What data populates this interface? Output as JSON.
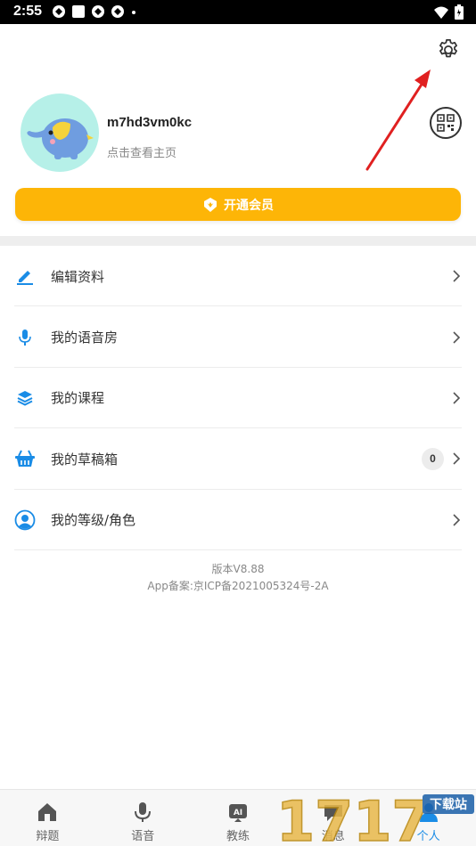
{
  "status_bar": {
    "time": "2:55"
  },
  "profile": {
    "username": "m7hd3vm0kc",
    "subtitle": "点击查看主页"
  },
  "vip_button": {
    "label": "开通会员"
  },
  "menu": {
    "items": [
      {
        "label": "编辑资料"
      },
      {
        "label": "我的语音房"
      },
      {
        "label": "我的课程"
      },
      {
        "label": "我的草稿箱",
        "badge": "0"
      },
      {
        "label": "我的等级/角色"
      }
    ]
  },
  "footer": {
    "version": "版本V8.88",
    "record": "App备案:京ICP备2021005324号-2A"
  },
  "tabbar": {
    "tabs": [
      {
        "label": "辩题",
        "icon": "home-icon"
      },
      {
        "label": "语音",
        "icon": "microphone-icon"
      },
      {
        "label": "教练",
        "icon": "ai-coach-icon"
      },
      {
        "label": "消息",
        "icon": "message-icon"
      },
      {
        "label": "个人",
        "icon": "person-icon"
      }
    ]
  },
  "watermark": {
    "text": "1717",
    "sub": "下载站"
  },
  "colors": {
    "accent": "#fdb507",
    "icon_blue": "#1a8ce6",
    "arrow": "#e02020"
  }
}
